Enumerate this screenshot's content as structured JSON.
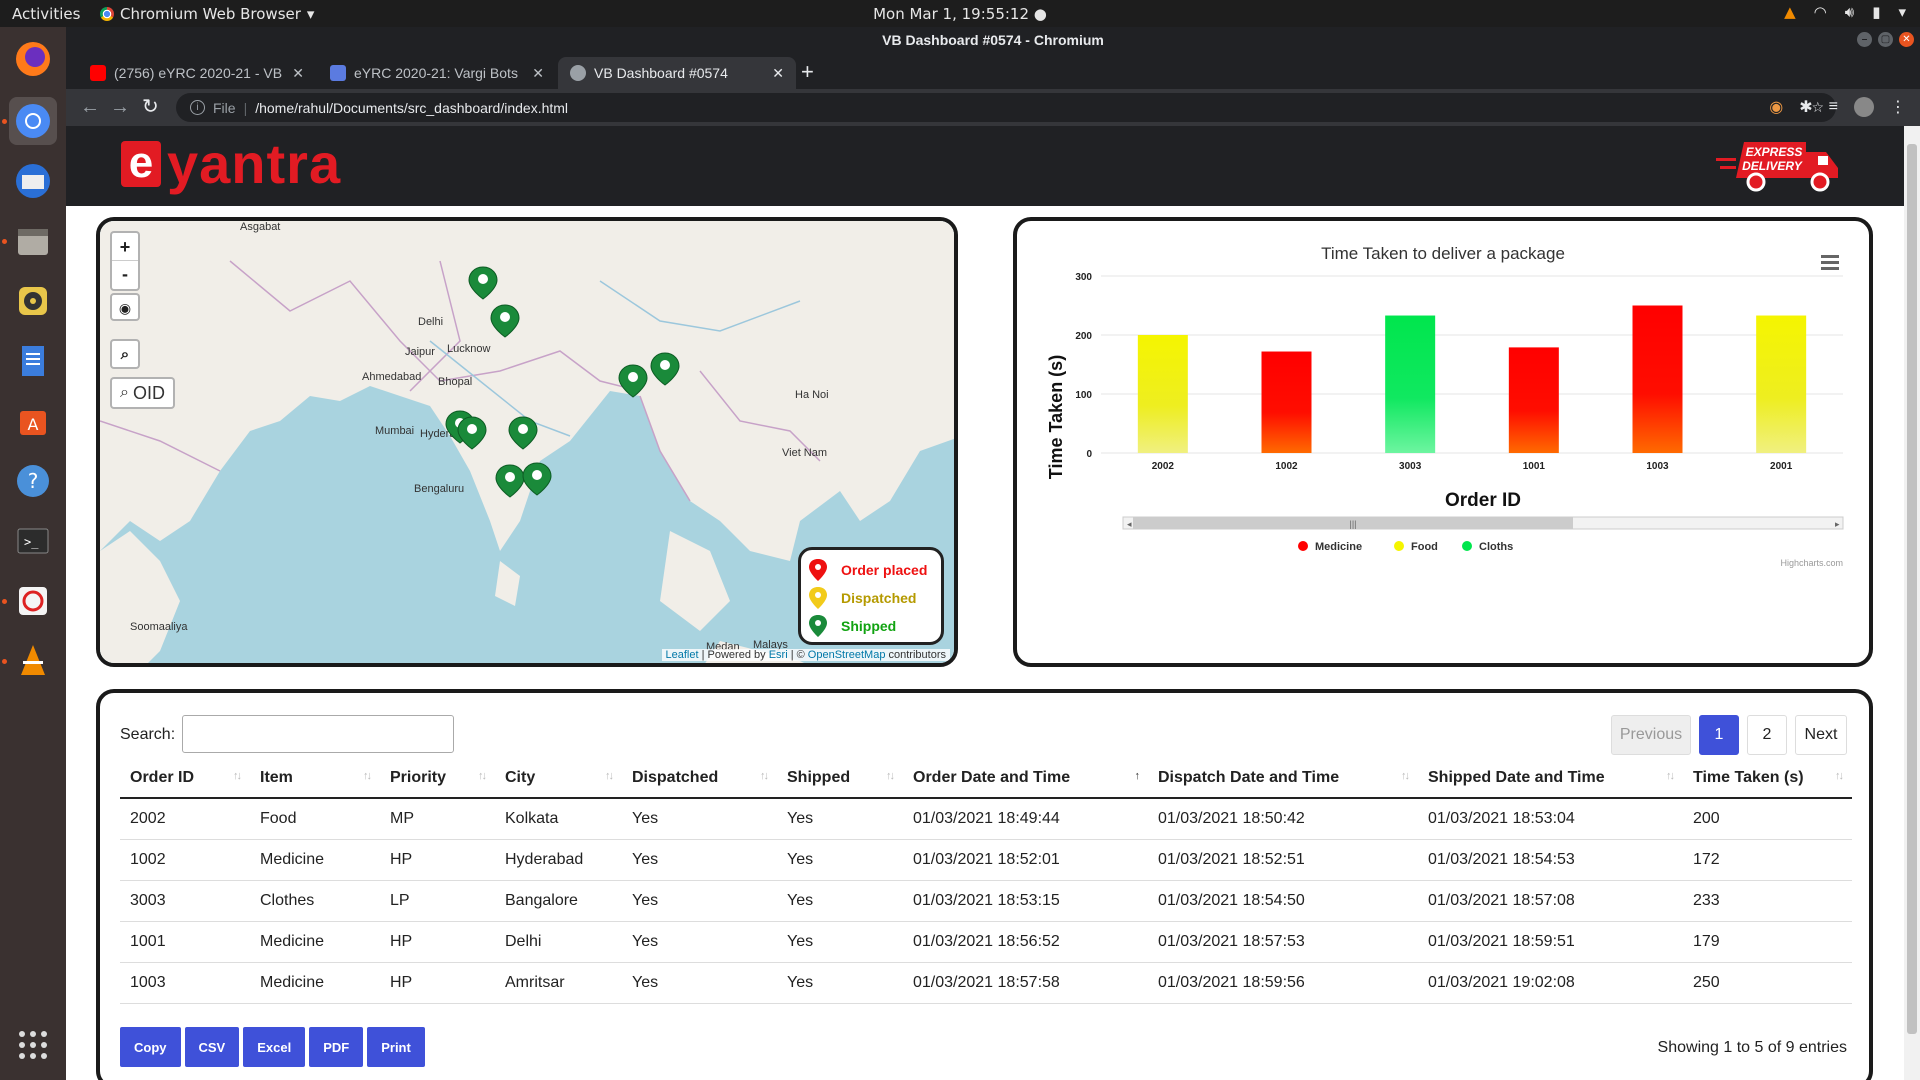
{
  "os": {
    "activities": "Activities",
    "app_name": "Chromium Web Browser",
    "clock": "Mon Mar  1, 19:55:12"
  },
  "browser": {
    "window_title": "VB Dashboard #0574 - Chromium",
    "tabs": [
      {
        "label": "(2756) eYRC 2020-21 - VB",
        "favicon_color": "#ff0000"
      },
      {
        "label": "eYRC 2020-21: Vargi Bots",
        "favicon_color": "#5b7be0"
      },
      {
        "label": "VB Dashboard #0574",
        "favicon_color": "#9aa0a6"
      }
    ],
    "omnibox": {
      "scheme_label": "File",
      "url": "/home/rahul/Documents/src_dashboard/index.html"
    }
  },
  "header": {
    "logo_letter": "e",
    "logo_word": "yantra",
    "truck_text_1": "EXPRESS",
    "truck_text_2": "DELIVERY"
  },
  "map": {
    "oid_label": "OID",
    "legend": [
      {
        "label": "Order placed",
        "color": "#ee1111"
      },
      {
        "label": "Dispatched",
        "color": "#e6c300"
      },
      {
        "label": "Shipped",
        "color": "#11a311"
      }
    ],
    "attribution": {
      "leaflet": "Leaflet",
      "powered": "| Powered by",
      "esri": "Esri",
      "sep": "| ©",
      "osm": "OpenStreetMap",
      "contrib": "contributors"
    },
    "place_labels": [
      "Asgabat",
      "Delhi",
      "Jaipur",
      "Lucknow",
      "Ahmedabad",
      "Bhopal",
      "Mumbai",
      "Hyderabad",
      "Bengaluru",
      "Medan",
      "Malays",
      "Soomaaliya",
      "Ha Noi",
      "Viet Nam"
    ]
  },
  "chart_data": {
    "type": "bar",
    "title": "Time Taken to deliver a package",
    "xlabel": "Order ID",
    "ylabel": "Time Taken (s)",
    "categories": [
      "2002",
      "1002",
      "3003",
      "1001",
      "1003",
      "2001"
    ],
    "values": [
      200,
      172,
      233,
      179,
      250,
      233
    ],
    "bar_category": [
      "Food",
      "Medicine",
      "Cloths",
      "Medicine",
      "Medicine",
      "Food"
    ],
    "ylim": [
      0,
      300
    ],
    "yticks": [
      0,
      100,
      200,
      300
    ],
    "legend": [
      {
        "name": "Medicine",
        "color": "#ff0000"
      },
      {
        "name": "Food",
        "color": "#f5f500"
      },
      {
        "name": "Cloths",
        "color": "#00e64d"
      }
    ],
    "legend_position": "bottom",
    "grid": true,
    "credits": "Highcharts.com"
  },
  "table": {
    "search_label": "Search:",
    "pagination": {
      "previous": "Previous",
      "pages": [
        "1",
        "2"
      ],
      "next": "Next"
    },
    "columns": [
      "Order ID",
      "Item",
      "Priority",
      "City",
      "Dispatched",
      "Shipped",
      "Order Date and Time",
      "Dispatch Date and Time",
      "Shipped Date and Time",
      "Time Taken (s)"
    ],
    "rows": [
      [
        "2002",
        "Food",
        "MP",
        "Kolkata",
        "Yes",
        "Yes",
        "01/03/2021 18:49:44",
        "01/03/2021 18:50:42",
        "01/03/2021 18:53:04",
        "200"
      ],
      [
        "1002",
        "Medicine",
        "HP",
        "Hyderabad",
        "Yes",
        "Yes",
        "01/03/2021 18:52:01",
        "01/03/2021 18:52:51",
        "01/03/2021 18:54:53",
        "172"
      ],
      [
        "3003",
        "Clothes",
        "LP",
        "Bangalore",
        "Yes",
        "Yes",
        "01/03/2021 18:53:15",
        "01/03/2021 18:54:50",
        "01/03/2021 18:57:08",
        "233"
      ],
      [
        "1001",
        "Medicine",
        "HP",
        "Delhi",
        "Yes",
        "Yes",
        "01/03/2021 18:56:52",
        "01/03/2021 18:57:53",
        "01/03/2021 18:59:51",
        "179"
      ],
      [
        "1003",
        "Medicine",
        "HP",
        "Amritsar",
        "Yes",
        "Yes",
        "01/03/2021 18:57:58",
        "01/03/2021 18:59:56",
        "01/03/2021 19:02:08",
        "250"
      ]
    ],
    "export_buttons": [
      "Copy",
      "CSV",
      "Excel",
      "PDF",
      "Print"
    ],
    "info": "Showing 1 to 5 of 9 entries"
  }
}
